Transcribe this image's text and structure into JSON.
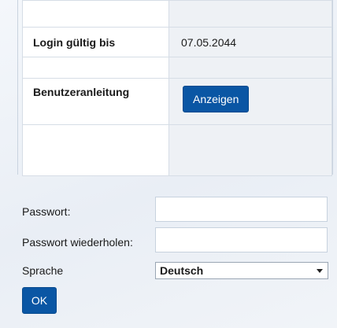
{
  "info": {
    "rows": [
      {
        "label": "",
        "value": ""
      },
      {
        "label": "Login gültig bis",
        "value": "07.05.2044"
      },
      {
        "label": "",
        "value": ""
      },
      {
        "label": "Benutzeranleitung",
        "button": "Anzeigen"
      },
      {
        "label": "",
        "value": ""
      }
    ]
  },
  "form": {
    "password_label": "Passwort:",
    "password_value": "",
    "password_repeat_label": "Passwort wiederholen:",
    "password_repeat_value": "",
    "language_label": "Sprache",
    "language_value": "Deutsch",
    "ok_label": "OK"
  },
  "colors": {
    "primary_button": "#0a56a4",
    "value_cell_bg": "#eef1f5"
  },
  "icons": {
    "select_arrow": "chevron-down-icon"
  }
}
